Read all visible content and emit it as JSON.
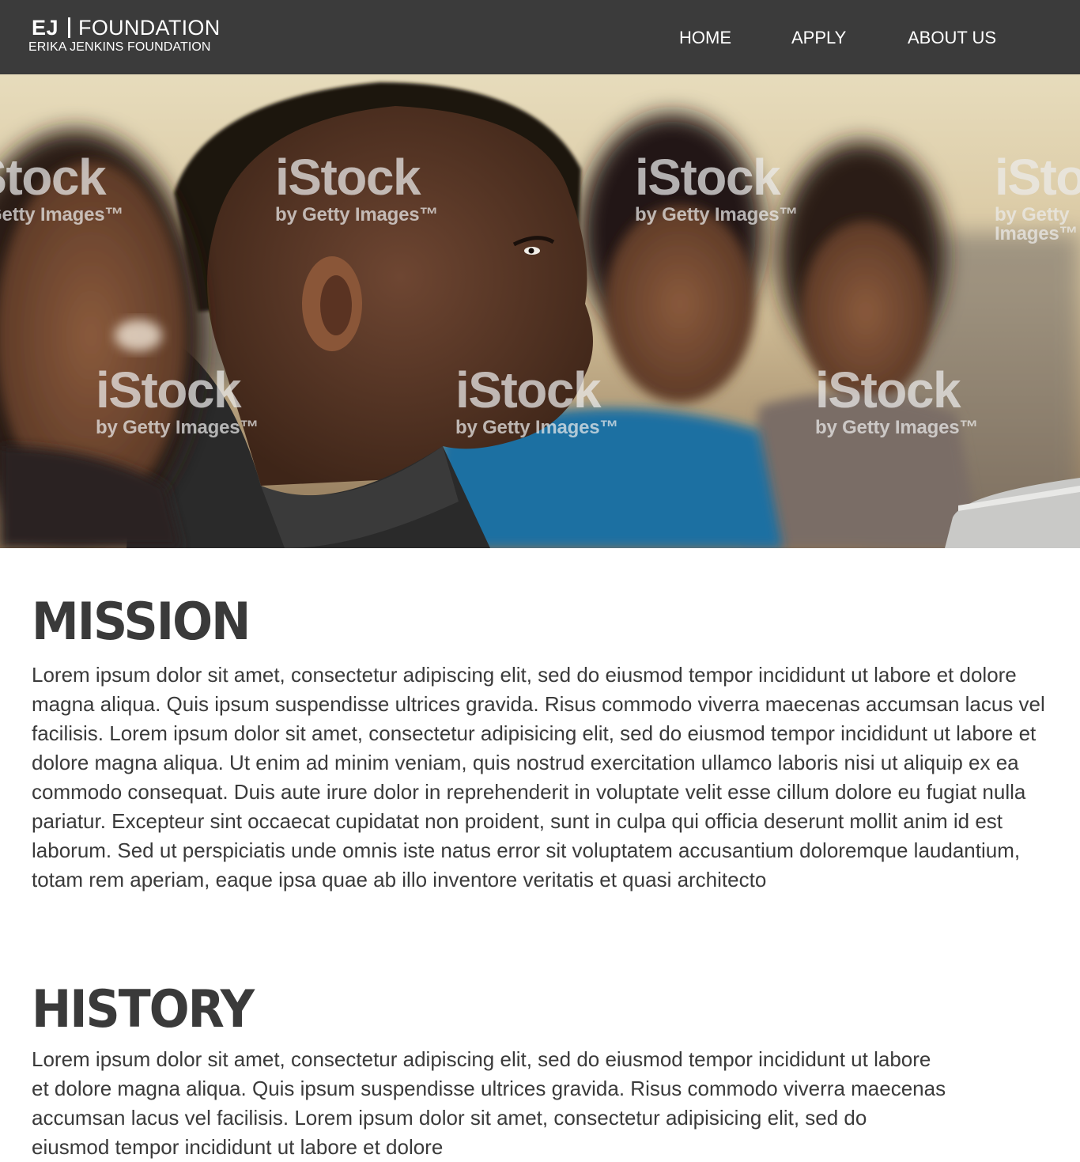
{
  "header": {
    "logo": {
      "initials": "EJ",
      "word": "FOUNDATION",
      "subtitle": "ERIKA JENKINS FOUNDATION"
    },
    "nav": [
      {
        "label": "HOME"
      },
      {
        "label": "APPLY"
      },
      {
        "label": "ABOUT US"
      }
    ]
  },
  "hero": {
    "watermark_main": "iStock",
    "watermark_sub": "by Getty Images™"
  },
  "mission": {
    "title": "MISSION",
    "body": "Lorem ipsum dolor sit amet, consectetur adipiscing elit, sed do eiusmod tempor incididunt ut labore et dolore magna aliqua. Quis ipsum suspendisse ultrices gravida. Risus commodo viverra maecenas accumsan lacus vel facilisis. Lorem ipsum dolor sit amet, consectetur adipisicing elit, sed do eiusmod tempor incididunt ut labore et dolore magna aliqua. Ut enim ad minim veniam, quis nostrud exercitation ullamco laboris nisi ut aliquip ex ea commodo consequat. Duis aute irure dolor in reprehenderit in voluptate velit esse cillum dolore eu fugiat nulla pariatur. Excepteur sint occaecat cupidatat non proident, sunt in culpa qui officia deserunt mollit anim id est laborum. Sed ut perspiciatis unde omnis iste natus error sit voluptatem accusantium doloremque laudantium, totam rem aperiam, eaque ipsa quae ab illo inventore veritatis et quasi architecto"
  },
  "history": {
    "title": "HISTORY",
    "body": "Lorem ipsum dolor sit amet, consectetur adipiscing elit, sed do eiusmod tempor incididunt ut labore et dolore magna aliqua. Quis ipsum suspendisse ultrices gravida. Risus commodo viverra maecenas accumsan lacus vel facilisis. Lorem ipsum dolor sit amet, consectetur adipisicing elit, sed do eiusmod tempor incididunt ut labore et dolore"
  },
  "colors": {
    "header_bg": "#3b3b3b",
    "text": "#3a3a3a",
    "background": "#ffffff"
  }
}
